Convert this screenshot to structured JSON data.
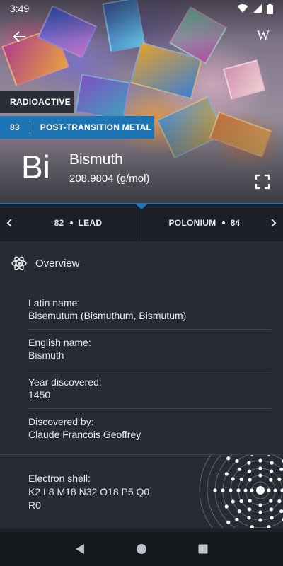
{
  "status_bar": {
    "time": "3:49"
  },
  "hero": {
    "badge": "RADIOACTIVE",
    "atomic_number": "83",
    "category": "POST-TRANSITION METAL",
    "symbol": "Bi",
    "name": "Bismuth",
    "mass": "208.9804 (g/mol)",
    "wiki_label": "W"
  },
  "navigation": {
    "prev_number": "82",
    "prev_name": "LEAD",
    "next_name": "POLONIUM",
    "next_number": "84"
  },
  "overview": {
    "title": "Overview",
    "properties": [
      {
        "label": "Latin name:",
        "value": "Bisemutum (Bismuthum, Bismutum)"
      },
      {
        "label": "English name:",
        "value": "Bismuth"
      },
      {
        "label": "Year discovered:",
        "value": "1450"
      },
      {
        "label": "Discovered by:",
        "value": "Claude Francois Geoffrey"
      }
    ],
    "electron_shell": {
      "label": "Electron shell:",
      "value_line1": "K2 L8 M18 N32 O18 P5 Q0",
      "value_line2": "R0"
    }
  },
  "colors": {
    "accent": "#1d75b5",
    "background": "#1e222b",
    "card": "#262b34"
  }
}
